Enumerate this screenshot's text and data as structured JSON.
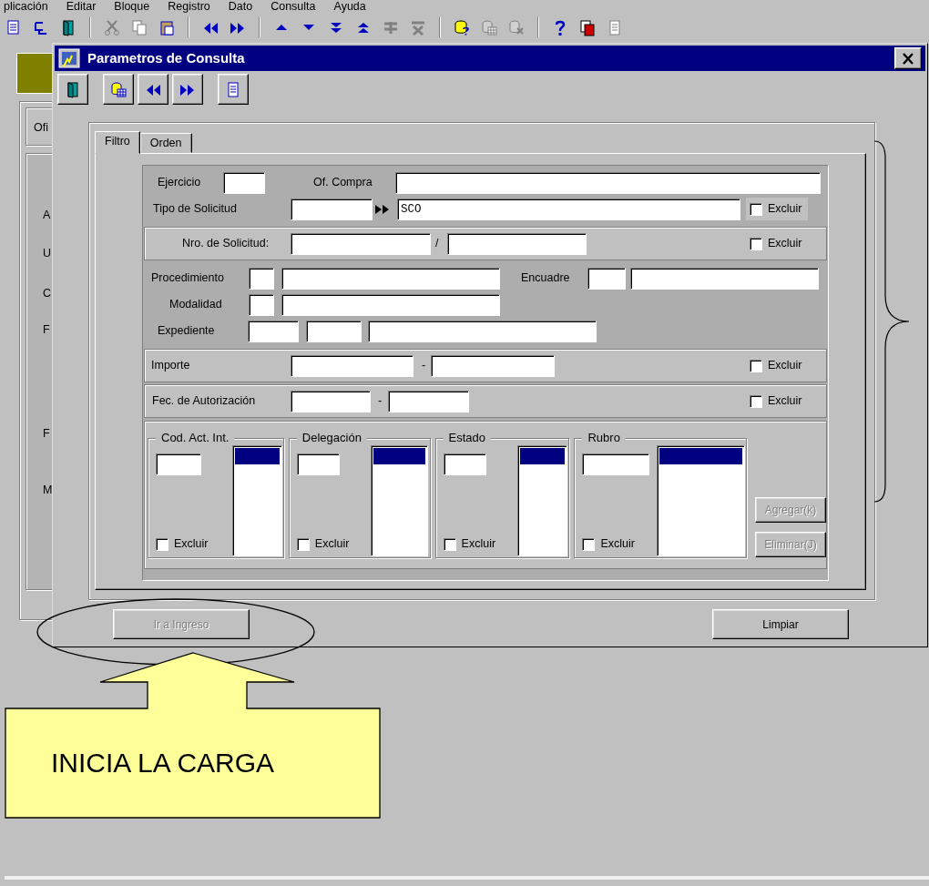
{
  "menu_bar": [
    "plicación",
    "Editar",
    "Bloque",
    "Registro",
    "Dato",
    "Consulta",
    "Ayuda"
  ],
  "toolbar": [
    {
      "kind": "list",
      "disabled": false
    },
    {
      "kind": "branch",
      "disabled": false
    },
    {
      "kind": "door"
    },
    {
      "kind": "separator"
    },
    {
      "kind": "cut",
      "disabled": true
    },
    {
      "kind": "copy",
      "disabled": true
    },
    {
      "kind": "paste",
      "disabled": false
    },
    {
      "kind": "separator"
    },
    {
      "kind": "prev",
      "disabled": false
    },
    {
      "kind": "next",
      "disabled": false
    },
    {
      "kind": "separator"
    },
    {
      "kind": "up",
      "disabled": false
    },
    {
      "kind": "down",
      "disabled": false
    },
    {
      "kind": "last",
      "disabled": false
    },
    {
      "kind": "first",
      "disabled": false
    },
    {
      "kind": "insert",
      "disabled": true
    },
    {
      "kind": "delete",
      "disabled": true
    },
    {
      "kind": "separator"
    },
    {
      "kind": "query"
    },
    {
      "kind": "db",
      "disabled": true
    },
    {
      "kind": "dbx",
      "disabled": true
    },
    {
      "kind": "separator"
    },
    {
      "kind": "help"
    },
    {
      "kind": "docs"
    },
    {
      "kind": "doc",
      "disabled": true
    }
  ],
  "background_window": {
    "tab": "Ofi",
    "labels": [
      "A",
      "U",
      "C",
      "F",
      "F",
      "M"
    ]
  },
  "dialog": {
    "title": "Parametros de Consulta",
    "toolbar": [
      {
        "kind": "door"
      },
      {
        "kind": "db"
      },
      {
        "kind": "prev"
      },
      {
        "kind": "next"
      },
      {
        "kind": "doc"
      }
    ],
    "tabs": [
      {
        "label": "Filtro",
        "selected": true
      },
      {
        "label": "Orden",
        "selected": false
      }
    ],
    "sections": [
      {
        "kind": "plain",
        "rows": [
          [
            {
              "kind": "label",
              "text": "Ejercicio"
            },
            {
              "kind": "input"
            },
            {
              "kind": "label",
              "text": "Of. Compra"
            },
            {
              "kind": "input"
            }
          ],
          [
            {
              "kind": "label",
              "text": "Tipo de Solicitud"
            },
            {
              "kind": "input"
            },
            {
              "kind": "lov"
            },
            {
              "kind": "input",
              "value": "SCO"
            },
            {
              "kind": "check",
              "text": "Excluir",
              "checked": false
            }
          ]
        ]
      },
      {
        "kind": "framed",
        "rows": [
          [
            {
              "kind": "label",
              "text": "Nro. de Solicitud:"
            },
            {
              "kind": "input"
            },
            {
              "kind": "label",
              "text": "/"
            },
            {
              "kind": "input"
            },
            {
              "kind": "check",
              "text": "Excluir",
              "checked": false
            }
          ]
        ]
      },
      {
        "kind": "plain",
        "rows": [
          [
            {
              "kind": "label",
              "text": "Procedimiento"
            },
            {
              "kind": "input"
            },
            {
              "kind": "input"
            },
            {
              "kind": "label",
              "text": "Encuadre"
            },
            {
              "kind": "input"
            },
            {
              "kind": "input"
            }
          ],
          [
            {
              "kind": "label",
              "text": "Modalidad"
            },
            {
              "kind": "input"
            },
            {
              "kind": "input"
            }
          ],
          [
            {
              "kind": "label",
              "text": "Expediente"
            },
            {
              "kind": "input"
            },
            {
              "kind": "input"
            },
            {
              "kind": "input"
            }
          ]
        ]
      },
      {
        "kind": "framed",
        "rows": [
          [
            {
              "kind": "label",
              "text": "Importe"
            },
            {
              "kind": "input"
            },
            {
              "kind": "label",
              "text": "-"
            },
            {
              "kind": "input"
            },
            {
              "kind": "check",
              "text": "Excluir",
              "checked": false
            }
          ]
        ]
      },
      {
        "kind": "framed",
        "rows": [
          [
            {
              "kind": "label",
              "text": "Fec. de Autorización"
            },
            {
              "kind": "input"
            },
            {
              "kind": "label",
              "text": "-"
            },
            {
              "kind": "input"
            },
            {
              "kind": "check",
              "text": "Excluir",
              "checked": false
            }
          ]
        ]
      }
    ],
    "lists": [
      {
        "title": "Cod. Act. Int.",
        "check": "Excluir",
        "checked": false,
        "rows": [
          {
            "selected": true
          }
        ]
      },
      {
        "title": "Delegación",
        "check": "Excluir",
        "checked": false,
        "rows": [
          {
            "selected": true
          }
        ]
      },
      {
        "title": "Estado",
        "check": "Excluir",
        "checked": false,
        "rows": [
          {
            "selected": true
          }
        ]
      },
      {
        "title": "Rubro",
        "check": "Excluir",
        "checked": false,
        "rows": [
          {
            "selected": true
          }
        ]
      }
    ],
    "side_buttons": [
      {
        "label": "Agregar(k)",
        "disabled": true
      },
      {
        "label": "Eliminar(J)",
        "disabled": true
      }
    ],
    "buttons": [
      {
        "label": "Ir a Ingreso",
        "disabled": true
      },
      {
        "label": "Limpiar",
        "disabled": false
      }
    ]
  },
  "annotation": {
    "text": "INICIA LA CARGA"
  }
}
